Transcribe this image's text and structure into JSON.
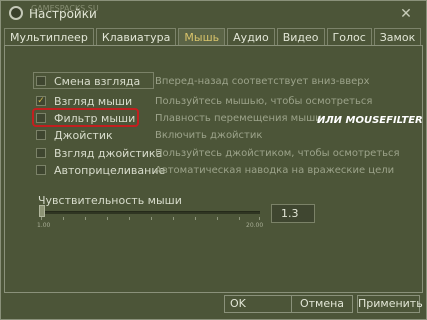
{
  "window": {
    "title": "Настройки",
    "watermark": "GAMESPACKS.SU",
    "close_glyph": "✕"
  },
  "tabs": [
    {
      "label": "Мультиплеер",
      "active": false
    },
    {
      "label": "Клавиатура",
      "active": false
    },
    {
      "label": "Мышь",
      "active": true
    },
    {
      "label": "Аудио",
      "active": false
    },
    {
      "label": "Видео",
      "active": false
    },
    {
      "label": "Голос",
      "active": false
    },
    {
      "label": "Замок",
      "active": false
    }
  ],
  "options": [
    {
      "label": "Смена взгляда",
      "checked": false,
      "desc": "Вперед-назад соответствует вниз-вверх"
    },
    {
      "label": "Взгляд мыши",
      "checked": true,
      "desc": "Пользуйтесь мышью, чтобы осмотреться"
    },
    {
      "label": "Фильтр мыши",
      "checked": false,
      "desc": "Плавность перемещения мыши"
    },
    {
      "label": "Джойстик",
      "checked": false,
      "desc": "Включить джойстик"
    },
    {
      "label": "Взгляд джойстика",
      "checked": false,
      "desc": "Пользуйтесь джойстиком, чтобы осмотреться"
    },
    {
      "label": "Автоприцеливание",
      "checked": false,
      "desc": "Автоматическая наводка на вражеские цели"
    }
  ],
  "annotation": {
    "note": "ИЛИ MOUSEFILTER",
    "highlight_color": "#c21f1f"
  },
  "sensitivity": {
    "label": "Чувствительность мыши",
    "min_label": "1.00",
    "max_label": "20.00",
    "value": "1.3",
    "position_fraction": 0.016
  },
  "buttons": {
    "ok": "OK",
    "cancel": "Отмена",
    "apply": "Применить"
  },
  "colors": {
    "background": "#4c5538",
    "accent": "#d8c36a",
    "check": "#d0b74e"
  }
}
